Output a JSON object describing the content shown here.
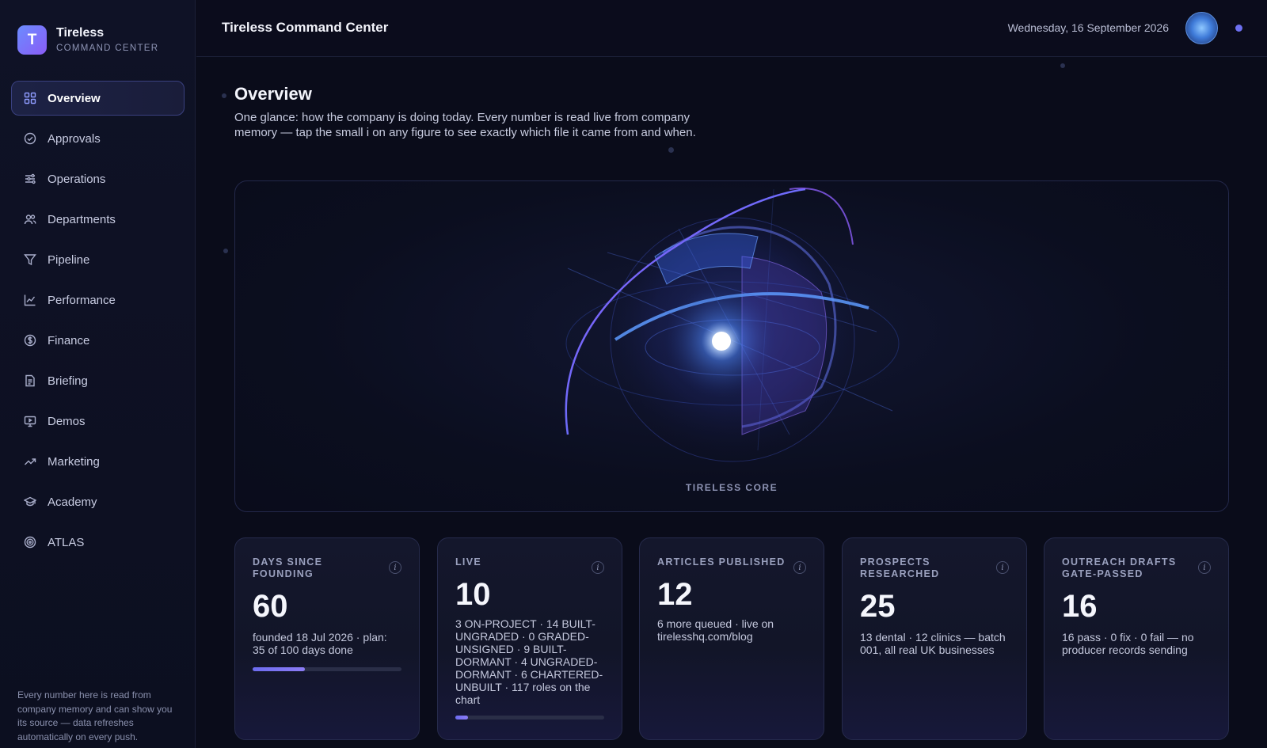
{
  "brand": {
    "logo_letter": "T",
    "name": "Tireless",
    "subtitle": "COMMAND CENTER"
  },
  "sidebar": {
    "items": [
      {
        "label": "Overview",
        "icon": "grid-icon",
        "active": true
      },
      {
        "label": "Approvals",
        "icon": "check-circle-icon"
      },
      {
        "label": "Operations",
        "icon": "sliders-icon"
      },
      {
        "label": "Departments",
        "icon": "users-icon"
      },
      {
        "label": "Pipeline",
        "icon": "filter-icon"
      },
      {
        "label": "Performance",
        "icon": "line-chart-icon"
      },
      {
        "label": "Finance",
        "icon": "dollar-circle-icon"
      },
      {
        "label": "Briefing",
        "icon": "document-icon"
      },
      {
        "label": "Demos",
        "icon": "monitor-icon"
      },
      {
        "label": "Marketing",
        "icon": "trending-up-icon"
      },
      {
        "label": "Academy",
        "icon": "graduation-cap-icon"
      },
      {
        "label": "ATLAS",
        "icon": "target-icon"
      }
    ],
    "footer": "Every number here is read from company memory and can show you its source — data refreshes automatically on every push."
  },
  "header": {
    "title": "Tireless Command Center",
    "date": "Wednesday, 16 September 2026"
  },
  "main": {
    "title": "Overview",
    "description": "One glance: how the company is doing today. Every number is read live from company memory — tap the small i on any figure to see exactly which file it came from and when.",
    "hero_label": "TIRELESS CORE",
    "info_glyph": "i"
  },
  "cards": [
    {
      "label": "DAYS SINCE FOUNDING",
      "value": "60",
      "sub": "founded 18 Jul 2026 · plan: 35 of 100 days done",
      "progress": 0.35
    },
    {
      "label": "LIVE",
      "value": "10",
      "sub": "3 ON-PROJECT · 14 BUILT-UNGRADED · 0 GRADED-UNSIGNED · 9 BUILT-DORMANT · 4 UNGRADED-DORMANT · 6 CHARTERED-UNBUILT · 117 roles on the chart",
      "progress": 0.085
    },
    {
      "label": "ARTICLES PUBLISHED",
      "value": "12",
      "sub": "6 more queued · live on tirelesshq.com/blog"
    },
    {
      "label": "PROSPECTS RESEARCHED",
      "value": "25",
      "sub": "13 dental · 12 clinics — batch 001, all real UK businesses"
    },
    {
      "label": "OUTREACH DRAFTS GATE-PASSED",
      "value": "16",
      "sub": "16 pass · 0 fix · 0 fail — no producer records sending"
    }
  ],
  "colors": {
    "accent": "#6d6cf0",
    "background": "#0a0c1a",
    "sidebar": "#0f1226"
  }
}
